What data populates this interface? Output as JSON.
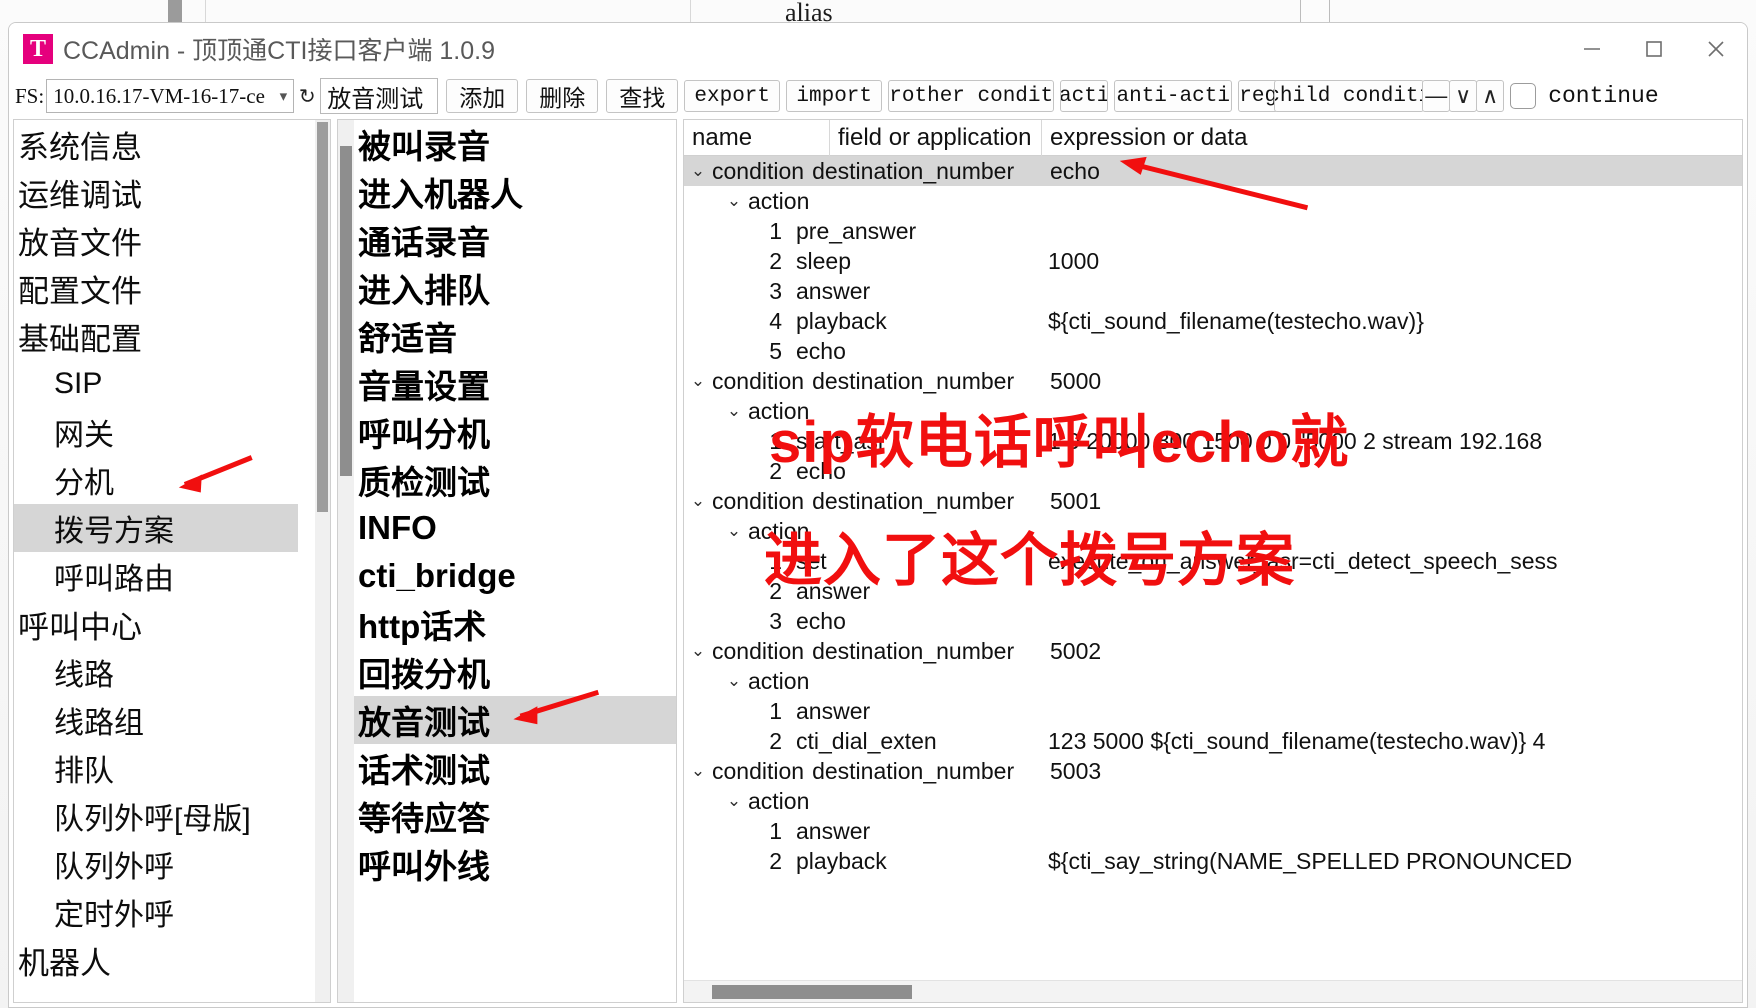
{
  "background": {
    "alias_label": "alias"
  },
  "window": {
    "logo_glyph": "T",
    "title": "CCAdmin - 顶顶通CTI接口客户端 1.0.9",
    "controls": {
      "minimize": "minimize-icon",
      "maximize": "maximize-icon",
      "close": "close-icon"
    }
  },
  "toolbar": {
    "fs_label": "FS:",
    "server_value": "10.0.16.17-VM-16-17-ce",
    "server_chevron": "▾",
    "refresh_icon": "↻",
    "name_value": "放音测试",
    "add_label": "添加",
    "delete_label": "删除",
    "find_label": "查找",
    "export_label": "export",
    "import_label": "import",
    "brother_condition_label": "brother conditi",
    "action_label": "acti",
    "anti_action_label": "anti-acti",
    "regex_label": "reg",
    "child_condition_label": "child conditi",
    "minus_glyph": "—",
    "down_glyph": "∨",
    "up_glyph": "∧",
    "continue_label": "continue"
  },
  "sidebar": {
    "items": [
      {
        "label": "系统信息",
        "level": 0,
        "selected": false
      },
      {
        "label": "运维调试",
        "level": 0,
        "selected": false
      },
      {
        "label": "放音文件",
        "level": 0,
        "selected": false
      },
      {
        "label": "配置文件",
        "level": 0,
        "selected": false
      },
      {
        "label": "基础配置",
        "level": 0,
        "selected": false
      },
      {
        "label": "SIP",
        "level": 1,
        "selected": false
      },
      {
        "label": "网关",
        "level": 1,
        "selected": false
      },
      {
        "label": "分机",
        "level": 1,
        "selected": false
      },
      {
        "label": "拨号方案",
        "level": 1,
        "selected": true
      },
      {
        "label": "呼叫路由",
        "level": 1,
        "selected": false
      },
      {
        "label": "呼叫中心",
        "level": 0,
        "selected": false
      },
      {
        "label": "线路",
        "level": 1,
        "selected": false
      },
      {
        "label": "线路组",
        "level": 1,
        "selected": false
      },
      {
        "label": "排队",
        "level": 1,
        "selected": false
      },
      {
        "label": "队列外呼[母版]",
        "level": 1,
        "selected": false
      },
      {
        "label": "队列外呼",
        "level": 1,
        "selected": false
      },
      {
        "label": "定时外呼",
        "level": 1,
        "selected": false
      },
      {
        "label": "机器人",
        "level": 0,
        "selected": false
      }
    ]
  },
  "dialplan_list": {
    "items": [
      {
        "label": "被叫录音",
        "selected": false
      },
      {
        "label": "进入机器人",
        "selected": false
      },
      {
        "label": "通话录音",
        "selected": false
      },
      {
        "label": "进入排队",
        "selected": false
      },
      {
        "label": "舒适音",
        "selected": false
      },
      {
        "label": "音量设置",
        "selected": false
      },
      {
        "label": "呼叫分机",
        "selected": false
      },
      {
        "label": "质检测试",
        "selected": false
      },
      {
        "label": "INFO",
        "selected": false
      },
      {
        "label": "cti_bridge",
        "selected": false
      },
      {
        "label": "http话术",
        "selected": false
      },
      {
        "label": "回拨分机",
        "selected": false
      },
      {
        "label": "放音测试",
        "selected": true
      },
      {
        "label": "话术测试",
        "selected": false
      },
      {
        "label": "等待应答",
        "selected": false
      },
      {
        "label": "呼叫外线",
        "selected": false
      }
    ]
  },
  "tree": {
    "columns": [
      "name",
      "field or application",
      "expression or data"
    ],
    "chevron_open": "⌄",
    "rows": [
      {
        "type": "condition",
        "name": "condition",
        "field": "destination_number",
        "expr": "echo",
        "selected": true
      },
      {
        "type": "action",
        "name": "action",
        "field": "",
        "expr": ""
      },
      {
        "type": "step",
        "num": "1",
        "app": "pre_answer",
        "expr": ""
      },
      {
        "type": "step",
        "num": "2",
        "app": "sleep",
        "expr": "1000"
      },
      {
        "type": "step",
        "num": "3",
        "app": "answer",
        "expr": ""
      },
      {
        "type": "step",
        "num": "4",
        "app": "playback",
        "expr": "${cti_sound_filename(testecho.wav)}"
      },
      {
        "type": "step",
        "num": "5",
        "app": "echo",
        "expr": ""
      },
      {
        "type": "condition",
        "name": "condition",
        "field": "destination_number",
        "expr": "5000",
        "selected": false
      },
      {
        "type": "action",
        "name": "action",
        "field": "",
        "expr": ""
      },
      {
        "type": "step",
        "num": "1",
        "app": "start_asr",
        "expr": "1 0 20000 800 1500 0 0 \"5000 2 stream 192.168"
      },
      {
        "type": "step",
        "num": "2",
        "app": "echo",
        "expr": ""
      },
      {
        "type": "condition",
        "name": "condition",
        "field": "destination_number",
        "expr": "5001",
        "selected": false
      },
      {
        "type": "action",
        "name": "action",
        "field": "",
        "expr": ""
      },
      {
        "type": "step",
        "num": "1",
        "app": "set",
        "expr": "execute_on_answer_asr=cti_detect_speech_sess"
      },
      {
        "type": "step",
        "num": "2",
        "app": "answer",
        "expr": ""
      },
      {
        "type": "step",
        "num": "3",
        "app": "echo",
        "expr": ""
      },
      {
        "type": "condition",
        "name": "condition",
        "field": "destination_number",
        "expr": "5002",
        "selected": false
      },
      {
        "type": "action",
        "name": "action",
        "field": "",
        "expr": ""
      },
      {
        "type": "step",
        "num": "1",
        "app": "answer",
        "expr": ""
      },
      {
        "type": "step",
        "num": "2",
        "app": "cti_dial_exten",
        "expr": "123 5000 ${cti_sound_filename(testecho.wav)} 4"
      },
      {
        "type": "condition",
        "name": "condition",
        "field": "destination_number",
        "expr": "5003",
        "selected": false
      },
      {
        "type": "action",
        "name": "action",
        "field": "",
        "expr": ""
      },
      {
        "type": "step",
        "num": "1",
        "app": "answer",
        "expr": ""
      },
      {
        "type": "step",
        "num": "2",
        "app": "playback",
        "expr": "${cti_say_string(NAME_SPELLED PRONOUNCED"
      }
    ]
  },
  "annotations": {
    "line1": "sip软电话呼叫echo就",
    "line2": "进入了这个拨号方案",
    "color": "#f10f0f"
  }
}
